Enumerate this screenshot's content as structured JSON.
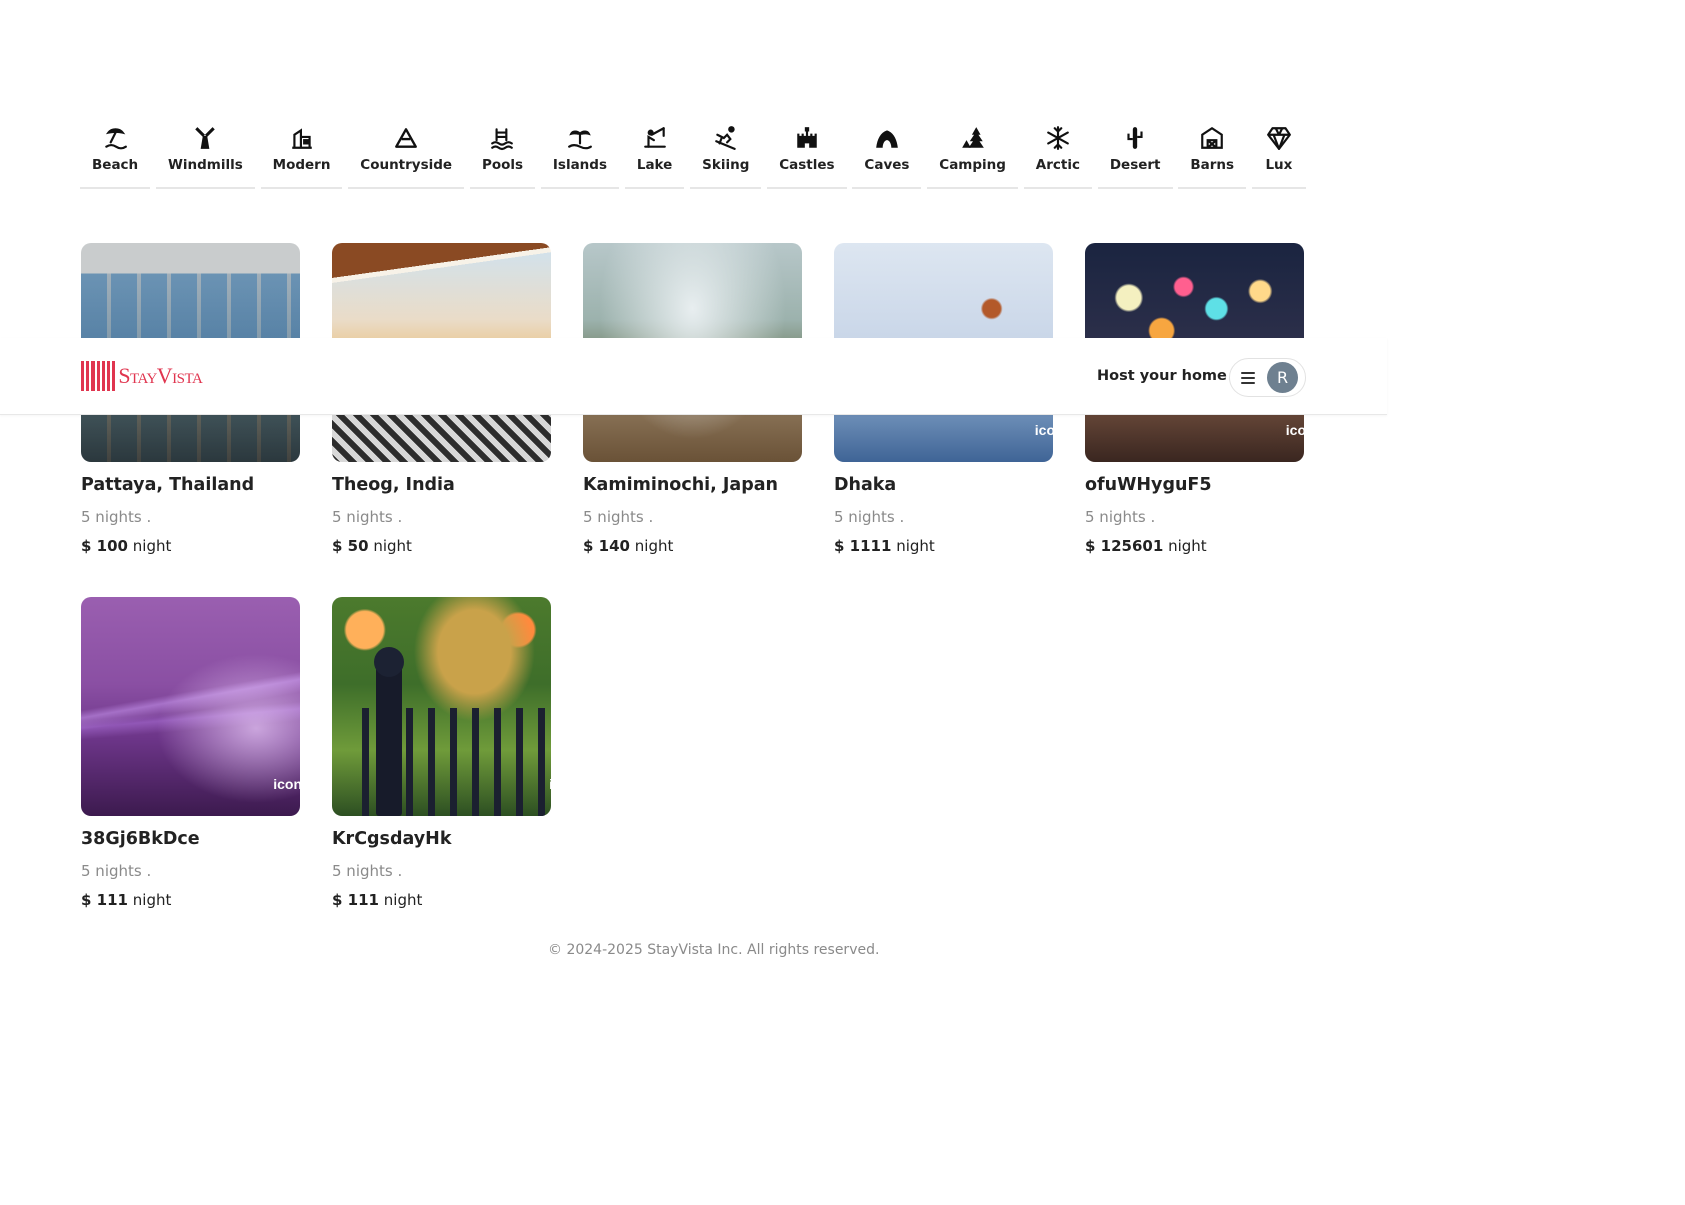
{
  "header": {
    "logo_text": "StayVista",
    "host_label": "Host your home",
    "avatar_initial": "R"
  },
  "categories": [
    {
      "label": "Beach",
      "icon": "beach-icon"
    },
    {
      "label": "Windmills",
      "icon": "windmill-icon"
    },
    {
      "label": "Modern",
      "icon": "modern-house-icon"
    },
    {
      "label": "Countryside",
      "icon": "mountain-icon"
    },
    {
      "label": "Pools",
      "icon": "pool-icon"
    },
    {
      "label": "Islands",
      "icon": "island-icon"
    },
    {
      "label": "Lake",
      "icon": "fishing-lake-icon"
    },
    {
      "label": "Skiing",
      "icon": "skiing-icon"
    },
    {
      "label": "Castles",
      "icon": "castle-icon"
    },
    {
      "label": "Caves",
      "icon": "cave-icon"
    },
    {
      "label": "Camping",
      "icon": "camping-icon"
    },
    {
      "label": "Arctic",
      "icon": "snowflake-icon"
    },
    {
      "label": "Desert",
      "icon": "cactus-icon"
    },
    {
      "label": "Barns",
      "icon": "barn-icon"
    },
    {
      "label": "Lux",
      "icon": "diamond-icon"
    }
  ],
  "listings": [
    {
      "title": "Pattaya, Thailand",
      "nights": "5 nights .",
      "currency": "$",
      "price": "100",
      "unit": "night"
    },
    {
      "title": "Theog, India",
      "nights": "5 nights .",
      "currency": "$",
      "price": "50",
      "unit": "night"
    },
    {
      "title": "Kamiminochi, Japan",
      "nights": "5 nights .",
      "currency": "$",
      "price": "140",
      "unit": "night"
    },
    {
      "title": "Dhaka",
      "nights": "5 nights .",
      "currency": "$",
      "price": "1111",
      "unit": "night"
    },
    {
      "title": "ofuWHyguF5",
      "nights": "5 nights .",
      "currency": "$",
      "price": "125601",
      "unit": "night"
    },
    {
      "title": "38Gj6BkDce",
      "nights": "5 nights .",
      "currency": "$",
      "price": "111",
      "unit": "night"
    },
    {
      "title": "KrCgsdayHk",
      "nights": "5 nights .",
      "currency": "$",
      "price": "111",
      "unit": "night"
    }
  ],
  "thumb_watermarks": [
    "",
    "",
    "",
    "ico",
    "ico",
    "icon",
    "i"
  ],
  "footer": {
    "copyright": "© 2024-2025 StayVista Inc. All rights reserved."
  },
  "colors": {
    "brand": "#e0354f",
    "avatar_bg": "#6e8090",
    "muted_text": "#8a8a8a"
  }
}
